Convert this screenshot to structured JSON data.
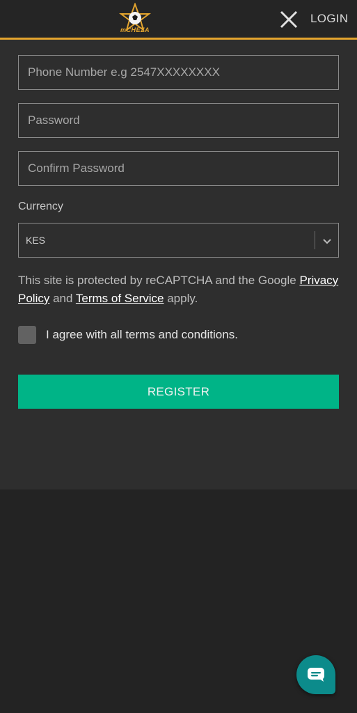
{
  "header": {
    "logo_text": "mCHEZA",
    "close_icon": "close-icon",
    "login_label": "LOGIN"
  },
  "form": {
    "phone_placeholder": "Phone Number e.g 2547XXXXXXXX",
    "password_placeholder": "Password",
    "confirm_password_placeholder": "Confirm Password",
    "currency_label": "Currency",
    "currency_value": "KES",
    "recaptcha_prefix": "This site is protected by reCAPTCHA and the Google",
    "privacy_policy_link": "Privacy Policy",
    "recaptcha_and": "and",
    "terms_link": "Terms of Service",
    "recaptcha_suffix": "apply.",
    "agree_label": "I agree with all terms and conditions.",
    "register_label": "REGISTER"
  },
  "colors": {
    "accent": "#e4a52e",
    "register_button": "#00b487",
    "chat_button": "#0c8b8b"
  },
  "chat": {
    "icon": "chat-bubble-icon"
  }
}
